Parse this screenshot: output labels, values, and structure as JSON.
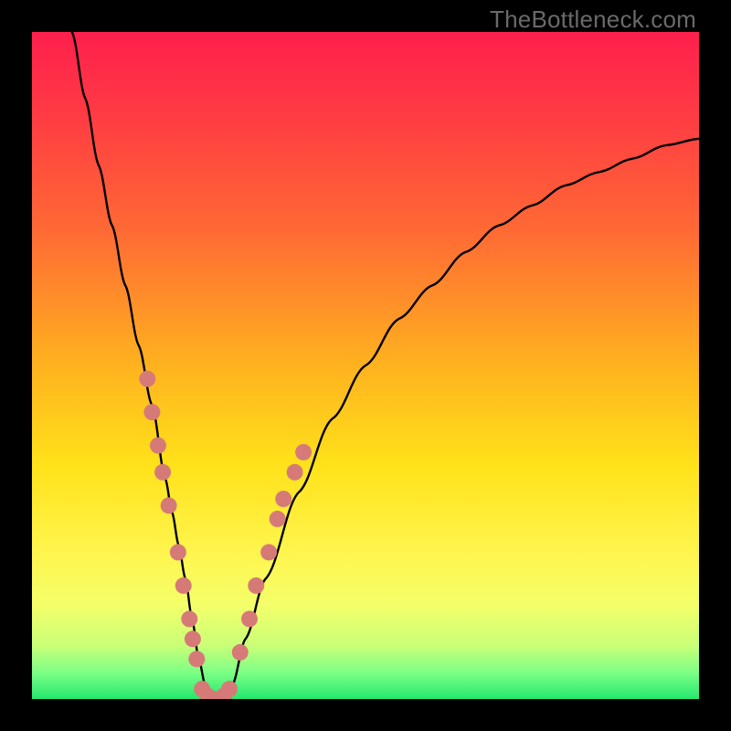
{
  "watermark": "TheBottleneck.com",
  "colors": {
    "frame": "#000000",
    "curve": "#000000",
    "dot": "#d67a78",
    "gradient_stops": [
      {
        "offset": 0.0,
        "color": "#ff1f4d"
      },
      {
        "offset": 0.12,
        "color": "#ff3a44"
      },
      {
        "offset": 0.3,
        "color": "#ff6a34"
      },
      {
        "offset": 0.5,
        "color": "#ffb21f"
      },
      {
        "offset": 0.65,
        "color": "#ffe21a"
      },
      {
        "offset": 0.78,
        "color": "#fff54e"
      },
      {
        "offset": 0.86,
        "color": "#f4ff6a"
      },
      {
        "offset": 0.92,
        "color": "#c9ff77"
      },
      {
        "offset": 0.96,
        "color": "#7dff86"
      },
      {
        "offset": 1.0,
        "color": "#24e86f"
      }
    ]
  },
  "chart_data": {
    "type": "line",
    "title": "",
    "xlabel": "",
    "ylabel": "",
    "xlim": [
      0,
      100
    ],
    "ylim": [
      0,
      100
    ],
    "series": [
      {
        "name": "bottleneck-curve",
        "x": [
          6,
          8,
          10,
          12,
          14,
          16,
          18,
          20,
          21,
          22,
          23,
          24,
          25,
          26,
          27,
          28,
          30,
          32,
          35,
          40,
          45,
          50,
          55,
          60,
          65,
          70,
          75,
          80,
          85,
          90,
          95,
          100
        ],
        "y": [
          100,
          90,
          80,
          71,
          62,
          53,
          44,
          33,
          28,
          23,
          18,
          12,
          6,
          2,
          0,
          0,
          2,
          9,
          18,
          31,
          42,
          50,
          57,
          62,
          67,
          71,
          74,
          77,
          79,
          81,
          83,
          84
        ]
      }
    ],
    "highlight_points": {
      "name": "marker-dots",
      "left_branch": [
        {
          "x": 17.3,
          "y": 48
        },
        {
          "x": 18.0,
          "y": 43
        },
        {
          "x": 18.9,
          "y": 38
        },
        {
          "x": 19.6,
          "y": 34
        },
        {
          "x": 20.5,
          "y": 29
        },
        {
          "x": 21.9,
          "y": 22
        },
        {
          "x": 22.7,
          "y": 17
        },
        {
          "x": 23.6,
          "y": 12
        },
        {
          "x": 24.1,
          "y": 9
        },
        {
          "x": 24.7,
          "y": 6
        }
      ],
      "trough": [
        {
          "x": 25.5,
          "y": 1.5
        },
        {
          "x": 26.3,
          "y": 0.5
        },
        {
          "x": 27.1,
          "y": 0.0
        },
        {
          "x": 28.0,
          "y": 0.0
        },
        {
          "x": 28.8,
          "y": 0.5
        },
        {
          "x": 29.6,
          "y": 1.5
        }
      ],
      "right_branch": [
        {
          "x": 31.2,
          "y": 7
        },
        {
          "x": 32.6,
          "y": 12
        },
        {
          "x": 33.6,
          "y": 17
        },
        {
          "x": 35.5,
          "y": 22
        },
        {
          "x": 36.8,
          "y": 27
        },
        {
          "x": 37.7,
          "y": 30
        },
        {
          "x": 39.4,
          "y": 34
        },
        {
          "x": 40.7,
          "y": 37
        }
      ]
    }
  }
}
